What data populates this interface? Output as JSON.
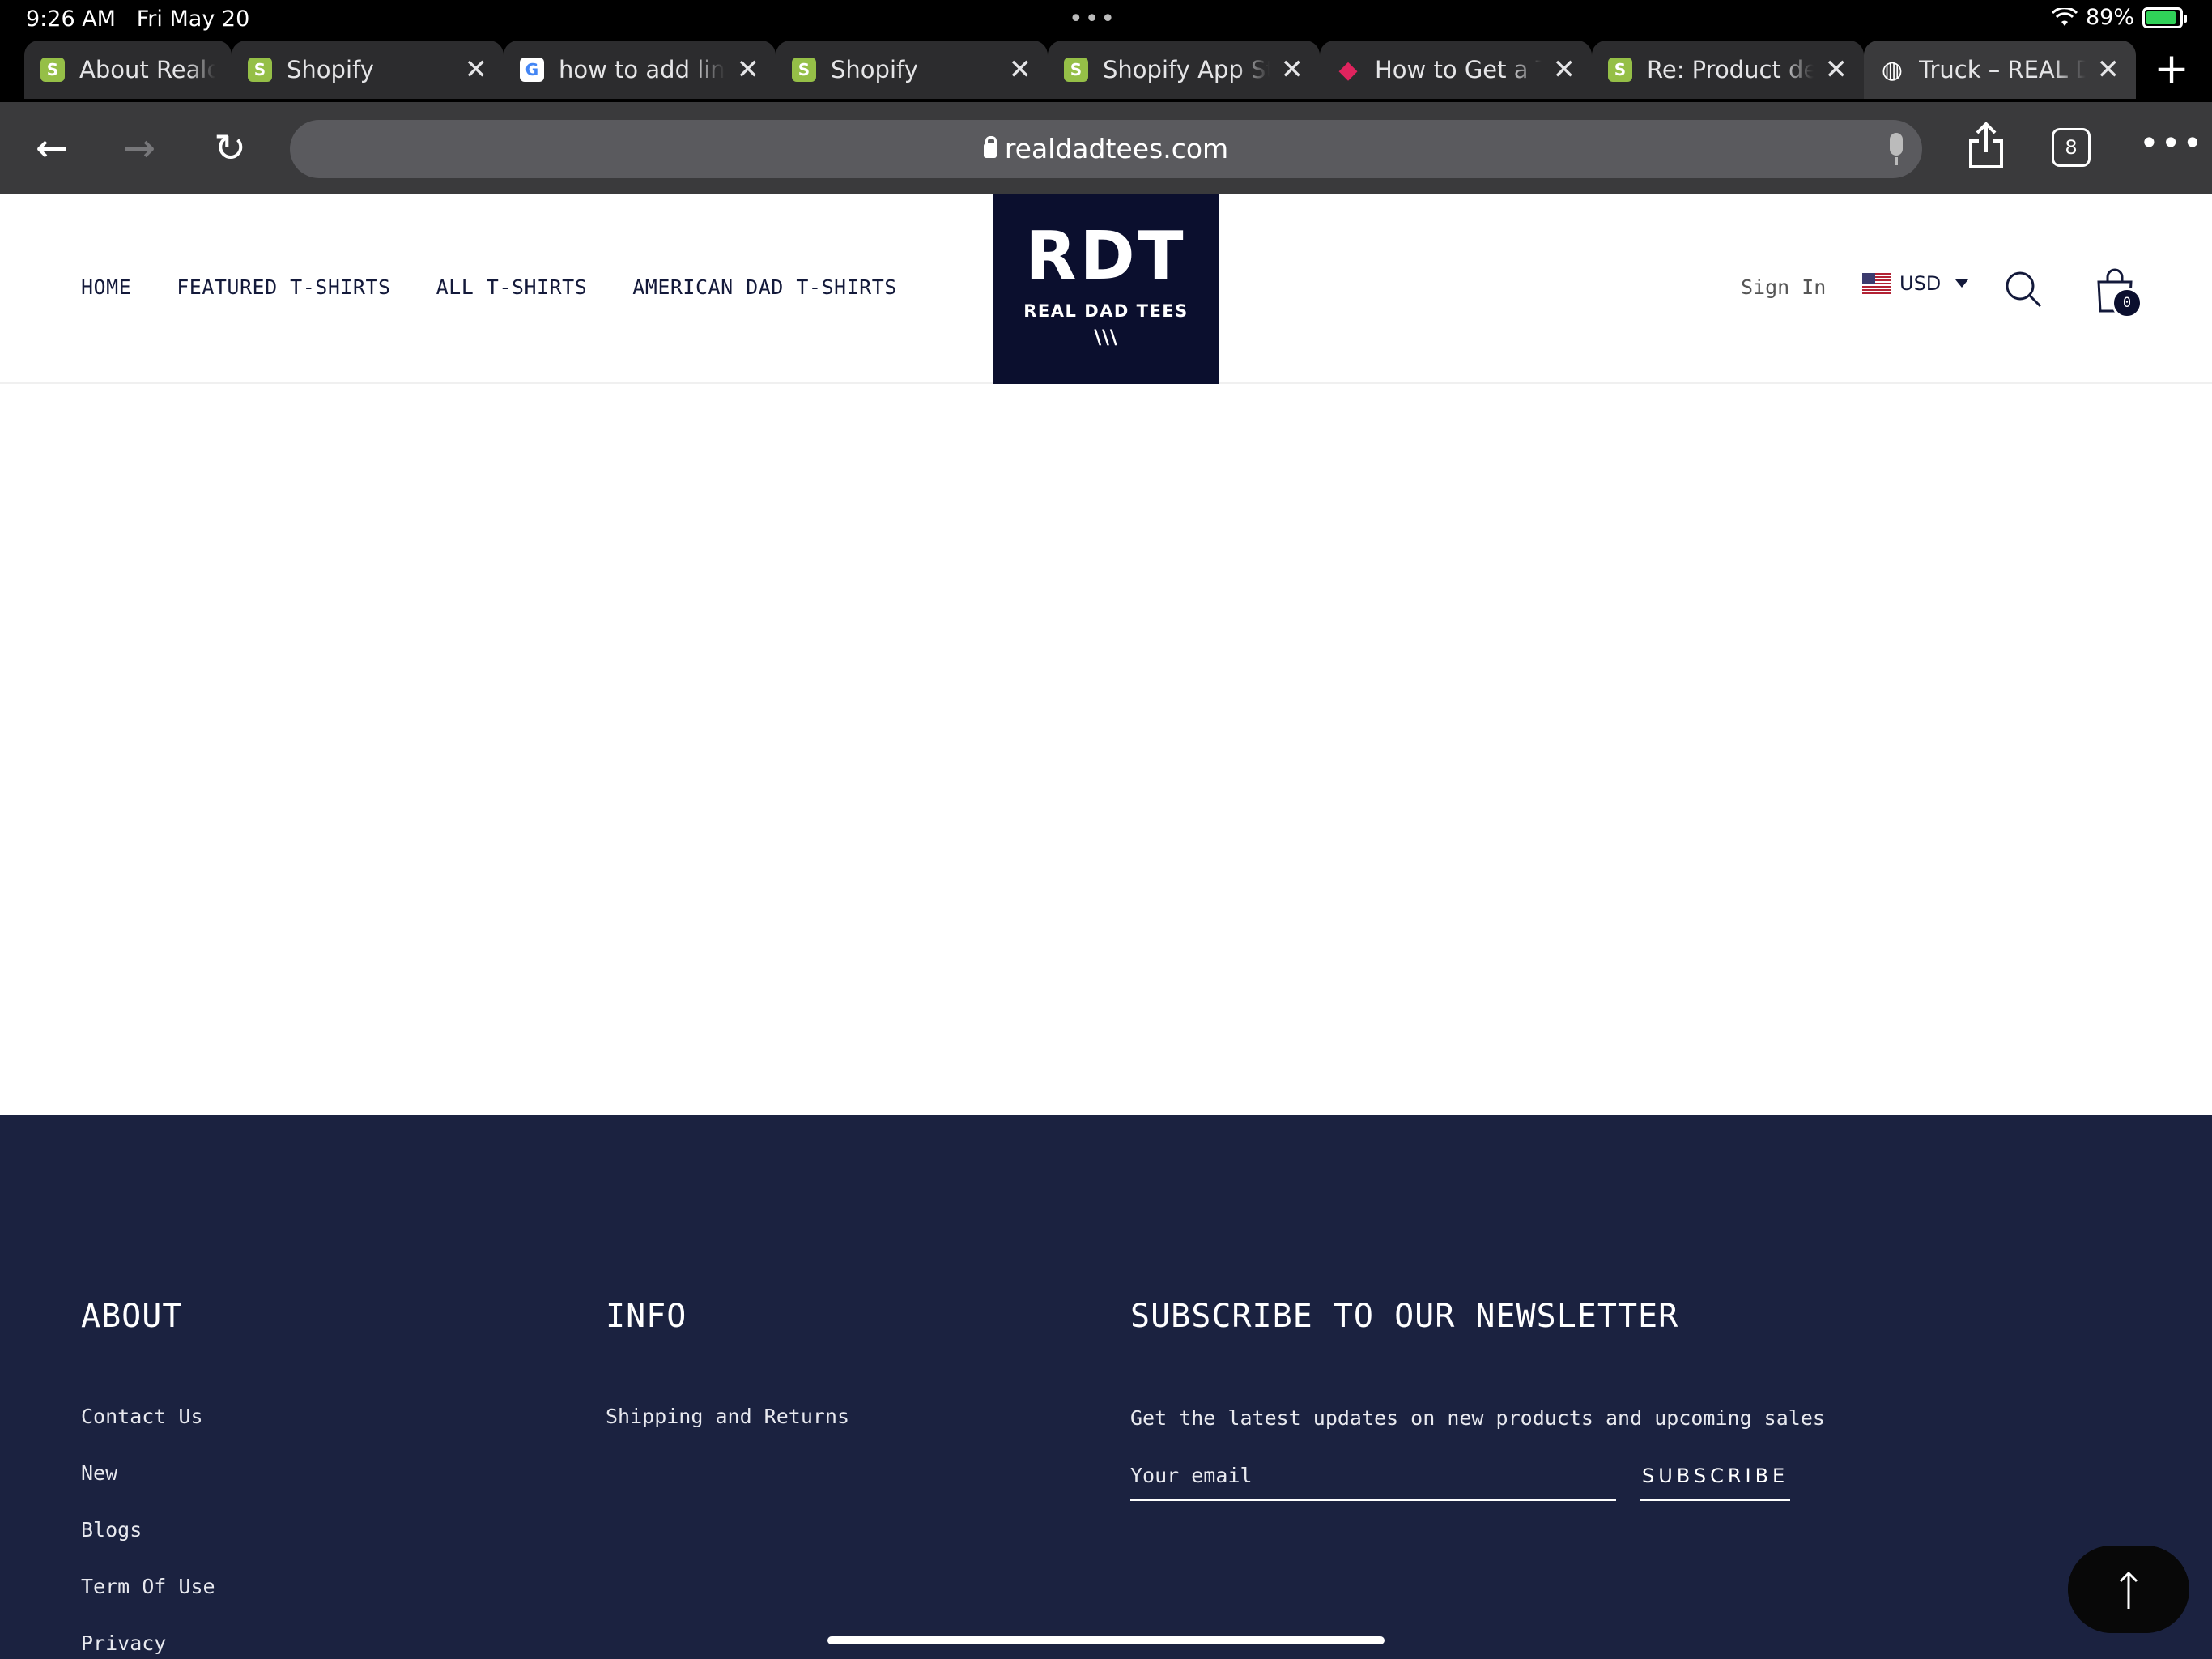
{
  "status_bar": {
    "time": "9:26 AM",
    "date": "Fri May 20",
    "battery": "89%"
  },
  "tabs": [
    {
      "label": "About Realdad",
      "favicon": "shopify-icon",
      "closable": false
    },
    {
      "label": "Shopify",
      "favicon": "shopify-icon",
      "closable": true
    },
    {
      "label": "how to add link",
      "favicon": "google-icon",
      "closable": true
    },
    {
      "label": "Shopify",
      "favicon": "shopify-icon",
      "closable": true
    },
    {
      "label": "Shopify App Sto",
      "favicon": "shopify-icon",
      "closable": true
    },
    {
      "label": "How to Get a Ti",
      "favicon": "red-bird-icon",
      "closable": true
    },
    {
      "label": "Re: Product des",
      "favicon": "shopify-icon",
      "closable": true
    },
    {
      "label": "Truck – REAL D",
      "favicon": "globe-icon",
      "closable": true,
      "active": true
    }
  ],
  "toolbar": {
    "url": "realdadtees.com",
    "tab_count": "8"
  },
  "site": {
    "nav": {
      "home": "HOME",
      "featured": "FEATURED T-SHIRTS",
      "all": "ALL T-SHIRTS",
      "american": "AMERICAN DAD T-SHIRTS"
    },
    "logo": {
      "big": "RDT",
      "small": "REAL DAD TEES",
      "marks": "\\\\\\"
    },
    "sign_in": "Sign In",
    "currency": "USD",
    "cart_count": "0",
    "brand_color": "#0b0f2e"
  },
  "footer": {
    "about": {
      "title": "ABOUT",
      "links": [
        "Contact Us",
        "New",
        "Blogs",
        "Term Of Use",
        "Privacy"
      ]
    },
    "info": {
      "title": "INFO",
      "links": [
        "Shipping and Returns"
      ]
    },
    "newsletter": {
      "title": "SUBSCRIBE TO OUR NEWSLETTER",
      "text": "Get the latest updates on new products and upcoming sales",
      "placeholder": "Your email",
      "button": "SUBSCRIBE"
    },
    "background": "#1b2240"
  }
}
